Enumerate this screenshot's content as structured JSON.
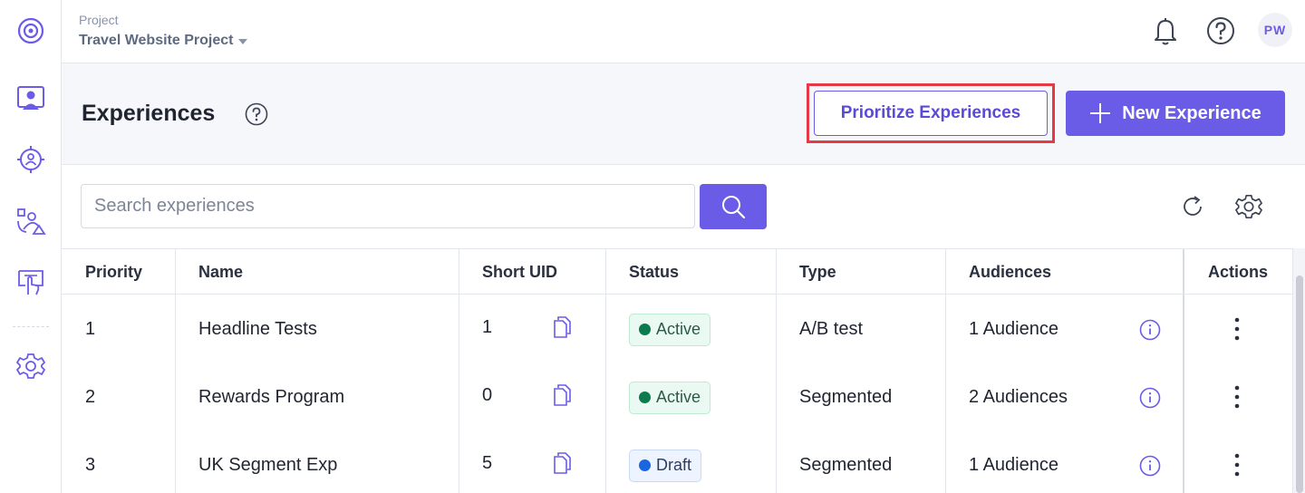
{
  "colors": {
    "accent": "#6b5ce7",
    "highlight": "#e53a46",
    "active_dot": "#0b7a4e",
    "draft_dot": "#1a66e0"
  },
  "sidebar": {
    "items": [
      {
        "name": "logo-target-icon"
      },
      {
        "name": "experiences-icon"
      },
      {
        "name": "targeting-icon"
      },
      {
        "name": "audiences-icon"
      },
      {
        "name": "touch-icon"
      },
      {
        "name": "settings-icon"
      }
    ]
  },
  "header": {
    "project_label": "Project",
    "project_name": "Travel Website Project",
    "avatar_initials": "PW"
  },
  "page": {
    "title": "Experiences",
    "prioritize_label": "Prioritize Experiences",
    "new_label": "New Experience"
  },
  "search": {
    "placeholder": "Search experiences",
    "value": ""
  },
  "table": {
    "columns": [
      "Priority",
      "Name",
      "Short UID",
      "Status",
      "Type",
      "Audiences",
      "Actions"
    ],
    "rows": [
      {
        "priority": "1",
        "name": "Headline Tests",
        "uid": "1",
        "status": "Active",
        "type": "A/B test",
        "audiences": "1 Audience"
      },
      {
        "priority": "2",
        "name": "Rewards Program",
        "uid": "0",
        "status": "Active",
        "type": "Segmented",
        "audiences": "2 Audiences"
      },
      {
        "priority": "3",
        "name": "UK Segment Exp",
        "uid": "5",
        "status": "Draft",
        "type": "Segmented",
        "audiences": "1 Audience"
      }
    ]
  }
}
